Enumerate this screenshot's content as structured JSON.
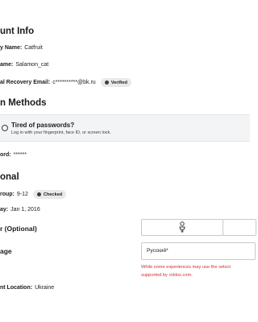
{
  "account_info": {
    "section_title": "unt Info",
    "display_name": {
      "label": "y Name:",
      "value": "Catfruit"
    },
    "username": {
      "label": "ame:",
      "value": "Salamon_cat"
    },
    "recovery_email": {
      "label": "al Recovery Email:",
      "value": "c**********@bk.ru",
      "badge": "Verified"
    }
  },
  "login_methods": {
    "section_title": "n Methods",
    "banner": {
      "title": "Tired of passwords?",
      "subtitle": "Log in with your fingerprint, face ID, or screen lock."
    },
    "password": {
      "label": "ord:",
      "value": "******"
    }
  },
  "personal": {
    "section_title": "onal",
    "age_group": {
      "label": "roup:",
      "value": "9-12",
      "badge": "Checked"
    },
    "birthday": {
      "label": "ay:",
      "value": "Jan 1, 2016"
    },
    "gender": {
      "label": "r (Optional)"
    },
    "language": {
      "label": "age",
      "selected": "Русский*",
      "warning_line1": "While some experiences may use the select",
      "warning_line2": "supported by roblox.com."
    },
    "location": {
      "label": "nt Location:",
      "value": "Ukraine"
    }
  },
  "colors": {
    "badge_bg": "#e8e9eb",
    "warning": "#d32f2f",
    "banner_bg": "#f2f4f5"
  }
}
